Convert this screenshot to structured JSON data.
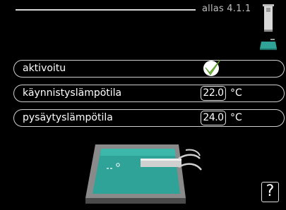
{
  "header": {
    "title": "allas 4.1.1",
    "icons": [
      "heat-pump-unit-icon",
      "pool-mini-icon"
    ]
  },
  "settings": [
    {
      "label": "aktivoitu",
      "checked": true,
      "icon": "checkmark-icon"
    },
    {
      "label": "käynnistyslämpötila",
      "value": "22.0",
      "unit": "°C"
    },
    {
      "label": "pysäytyslämpötila",
      "value": "24.0",
      "unit": "°C"
    }
  ],
  "help": {
    "label": "?"
  },
  "colors": {
    "accent_teal": "#2fa397",
    "check_green": "#7cc241",
    "border": "#cfcfcf"
  }
}
